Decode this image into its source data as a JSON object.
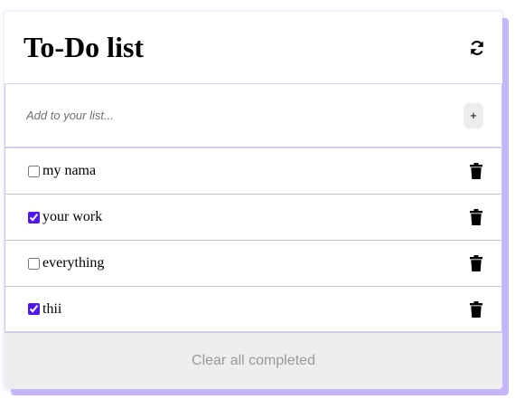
{
  "header": {
    "title": "To-Do list",
    "refresh_icon": "refresh-icon"
  },
  "add": {
    "placeholder": "Add to your list...",
    "value": "",
    "button_label": "+"
  },
  "items": [
    {
      "label": "my nama",
      "completed": false
    },
    {
      "label": "your work",
      "completed": true
    },
    {
      "label": "everything",
      "completed": false
    },
    {
      "label": "thii",
      "completed": true
    }
  ],
  "footer": {
    "clear_label": "Clear all completed"
  },
  "colors": {
    "accent": "#4f17f2",
    "shadow": "#c4b5fd",
    "footer_bg": "#eeeeee"
  }
}
